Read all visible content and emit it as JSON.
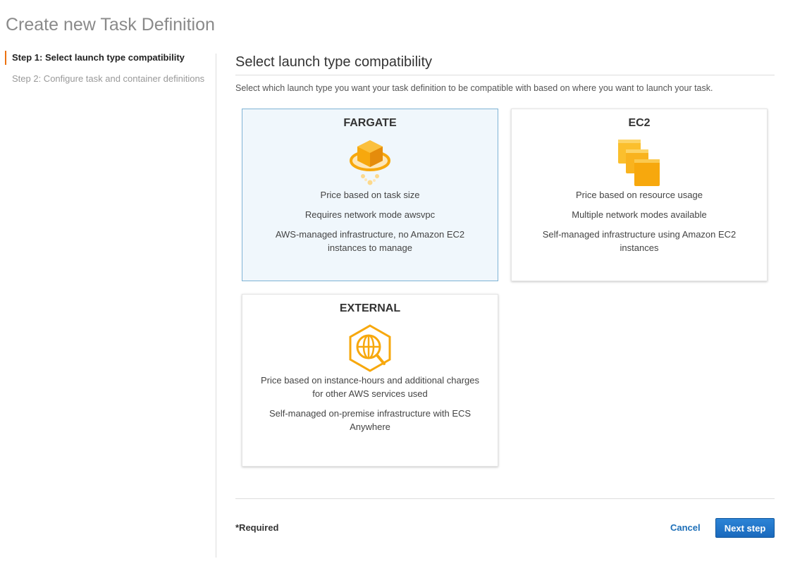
{
  "page": {
    "title": "Create new Task Definition"
  },
  "steps": [
    {
      "label": "Step 1: Select launch type compatibility",
      "active": true
    },
    {
      "label": "Step 2: Configure task and container definitions",
      "active": false
    }
  ],
  "section": {
    "title": "Select launch type compatibility",
    "description": "Select which launch type you want your task definition to be compatible with based on where you want to launch your task."
  },
  "cards": {
    "fargate": {
      "title": "FARGATE",
      "icon": "fargate-icon",
      "selected": true,
      "lines": [
        "Price based on task size",
        "Requires network mode awsvpc",
        "AWS-managed infrastructure, no Amazon EC2 instances to manage"
      ]
    },
    "ec2": {
      "title": "EC2",
      "icon": "ec2-instances-icon",
      "selected": false,
      "lines": [
        "Price based on resource usage",
        "Multiple network modes available",
        "Self-managed infrastructure using Amazon EC2 instances"
      ]
    },
    "external": {
      "title": "EXTERNAL",
      "icon": "external-anywhere-icon",
      "selected": false,
      "lines": [
        "Price based on instance-hours and additional charges for other AWS services used",
        "Self-managed on-premise infrastructure with ECS Anywhere"
      ]
    }
  },
  "footer": {
    "required_note": "*Required",
    "cancel_label": "Cancel",
    "next_label": "Next step"
  },
  "colors": {
    "accent": "#ec7211",
    "link": "#1d6fb8",
    "primary_button": "#1a69bd",
    "selected_card_bg": "#f0f7fc",
    "selected_card_border": "#7fb3d5",
    "icon_orange": "#f7a80d"
  }
}
